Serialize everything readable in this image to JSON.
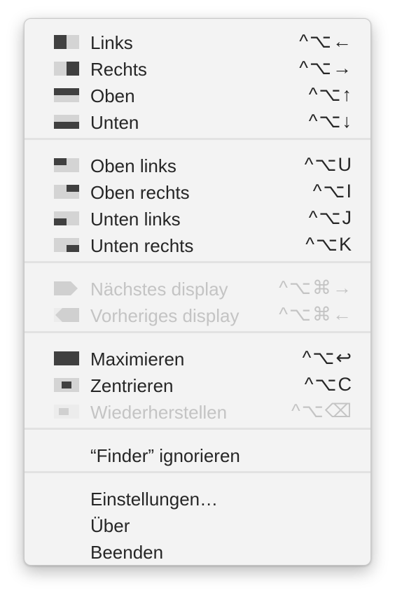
{
  "colors": {
    "dark": "#404040",
    "light": "#d4d4d4",
    "disabledDark": "#d0d0d0",
    "disabledLight": "#ececec"
  },
  "menu": {
    "halves": [
      {
        "label": "Links",
        "shortcut": "^⌥←",
        "icon": "left-half-icon"
      },
      {
        "label": "Rechts",
        "shortcut": "^⌥→",
        "icon": "right-half-icon"
      },
      {
        "label": "Oben",
        "shortcut": "^⌥↑",
        "icon": "top-half-icon"
      },
      {
        "label": "Unten",
        "shortcut": "^⌥↓",
        "icon": "bottom-half-icon"
      }
    ],
    "corners": [
      {
        "label": "Oben links",
        "shortcut": "^⌥U",
        "icon": "top-left-quarter-icon"
      },
      {
        "label": "Oben rechts",
        "shortcut": "^⌥I",
        "icon": "top-right-quarter-icon"
      },
      {
        "label": "Unten links",
        "shortcut": "^⌥J",
        "icon": "bottom-left-quarter-icon"
      },
      {
        "label": "Unten rechts",
        "shortcut": "^⌥K",
        "icon": "bottom-right-quarter-icon"
      }
    ],
    "displays": [
      {
        "label": "Nächstes display",
        "shortcut": "^⌥⌘→",
        "icon": "next-display-icon",
        "disabled": true
      },
      {
        "label": "Vorheriges display",
        "shortcut": "^⌥⌘←",
        "icon": "previous-display-icon",
        "disabled": true
      }
    ],
    "window": [
      {
        "label": "Maximieren",
        "shortcut": "^⌥↩",
        "icon": "maximize-icon"
      },
      {
        "label": "Zentrieren",
        "shortcut": "^⌥C",
        "icon": "center-icon"
      },
      {
        "label": "Wiederherstellen",
        "shortcut": "^⌥⌫",
        "icon": "restore-icon",
        "disabled": true
      }
    ],
    "ignore": {
      "label": "“Finder” ignorieren"
    },
    "app": [
      {
        "label": "Einstellungen…"
      },
      {
        "label": "Über"
      },
      {
        "label": "Beenden"
      }
    ]
  }
}
